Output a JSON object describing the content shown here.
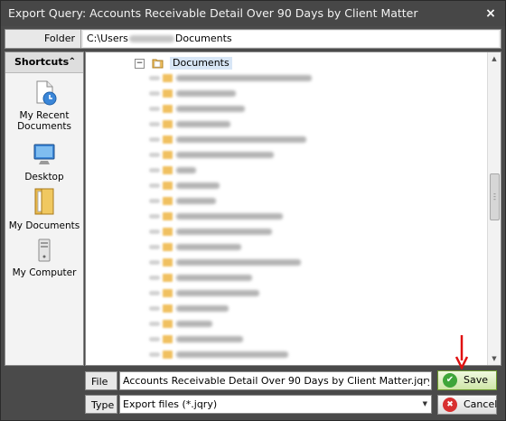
{
  "window": {
    "title": "Export Query: Accounts Receivable Detail Over 90 Days by Client Matter",
    "close_glyph": "×"
  },
  "folder": {
    "label": "Folder",
    "path_prefix": "C:\\Users",
    "path_suffix": "Documents"
  },
  "shortcuts": {
    "header": "Shortcuts",
    "collapse_glyph": "≈",
    "items": [
      {
        "label": "My Recent Documents",
        "icon": "recent-documents-icon"
      },
      {
        "label": "Desktop",
        "icon": "desktop-icon"
      },
      {
        "label": "My Documents",
        "icon": "my-documents-icon"
      },
      {
        "label": "My Computer",
        "icon": "my-computer-icon"
      }
    ]
  },
  "tree": {
    "root_label": "Documents",
    "root_expander": "⊟"
  },
  "file": {
    "label": "File",
    "value": "Accounts Receivable Detail Over 90 Days by Client Matter.jqry"
  },
  "type": {
    "label": "Type",
    "selected": "Export files (*.jqry)"
  },
  "buttons": {
    "save": "Save",
    "cancel": "Cancel"
  },
  "colors": {
    "titlebar": "#474747",
    "annotation_arrow": "#e01010",
    "save_green": "#3fa53a",
    "cancel_red": "#d83030"
  }
}
